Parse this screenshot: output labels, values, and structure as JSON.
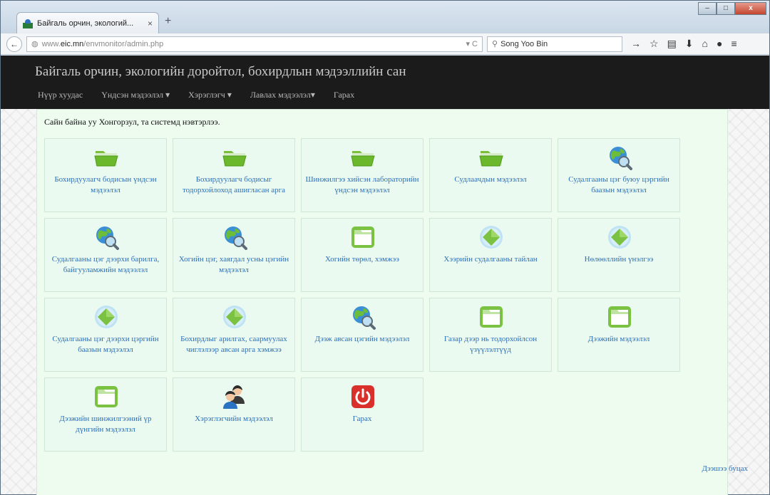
{
  "browser": {
    "tab_title": "Байгаль орчин, экологий...",
    "tab_close": "×",
    "new_tab": "+",
    "url_prefix": "www.",
    "url_domain": "eic.mn",
    "url_path": "/envmonitor/admin.php",
    "search_value": "Song Yoo Bin",
    "win_min": "–",
    "win_max": "□",
    "win_close": "x"
  },
  "site": {
    "title": "Байгаль орчин, экологийн доройтол, бохирдлын мэдээллийн сан",
    "nav": [
      "Нүүр хуудас",
      "Үндсэн мэдээлэл ▾",
      "Хэрэглэгч ▾",
      "Лавлах мэдээлэл▾",
      "Гарах"
    ],
    "welcome": "Сайн байна уу Хонгорзул, та системд нэвтэрлээ.",
    "back_link": "Дээшээ буцах"
  },
  "tiles": [
    {
      "label": "Бохирдуулагч бодисын үндсэн мэдээлэл",
      "icon": "open-folder-icon"
    },
    {
      "label": "Бохирдуулагч бодисыг тодорхойлоход ашигласан арга",
      "icon": "open-folder-icon"
    },
    {
      "label": "Шинжилгээ хийсэн лабораторийн үндсэн мэдээлэл",
      "icon": "open-folder-icon"
    },
    {
      "label": "Судлаачдын мэдээлэл",
      "icon": "open-folder-icon"
    },
    {
      "label": "Судалгааны цэг буюу цэргийн баазын мэдээлэл",
      "icon": "globe-search-icon"
    },
    {
      "label": "Судалгааны цэг дээрхи барилга, байгууламжийн мэдээлэл",
      "icon": "globe-search-icon"
    },
    {
      "label": "Хогийн цэг, хаягдал усны цэгийн мэдээлэл",
      "icon": "globe-search-icon"
    },
    {
      "label": "Хогийн төрөл, хэмжээ",
      "icon": "folder-icon"
    },
    {
      "label": "Хээрийн судалгааны тайлан",
      "icon": "diamond-icon"
    },
    {
      "label": "Нөлөөллийн үнэлгээ",
      "icon": "diamond-icon"
    },
    {
      "label": "Судалгааны цэг дээрхи цэргийн баазын мэдээлэл",
      "icon": "diamond-icon"
    },
    {
      "label": "Бохирдлыг арилгах, саармуулах чиглэлээр авсан арга хэмжээ",
      "icon": "diamond-icon"
    },
    {
      "label": "Дээж авсан цэгийн мэдээлэл",
      "icon": "globe-search-icon"
    },
    {
      "label": "Газар дээр нь тодорхойлсон үзүүлэлтүүд",
      "icon": "folder-icon"
    },
    {
      "label": "Дээжийн мэдээлэл",
      "icon": "folder-icon"
    },
    {
      "label": "Дээжийн шинжилгээний үр дүнгийн мэдээлэл",
      "icon": "folder-icon"
    },
    {
      "label": "Хэрэглэгчийн мэдээлэл",
      "icon": "users-icon"
    },
    {
      "label": "Гарах",
      "icon": "power-icon"
    }
  ]
}
